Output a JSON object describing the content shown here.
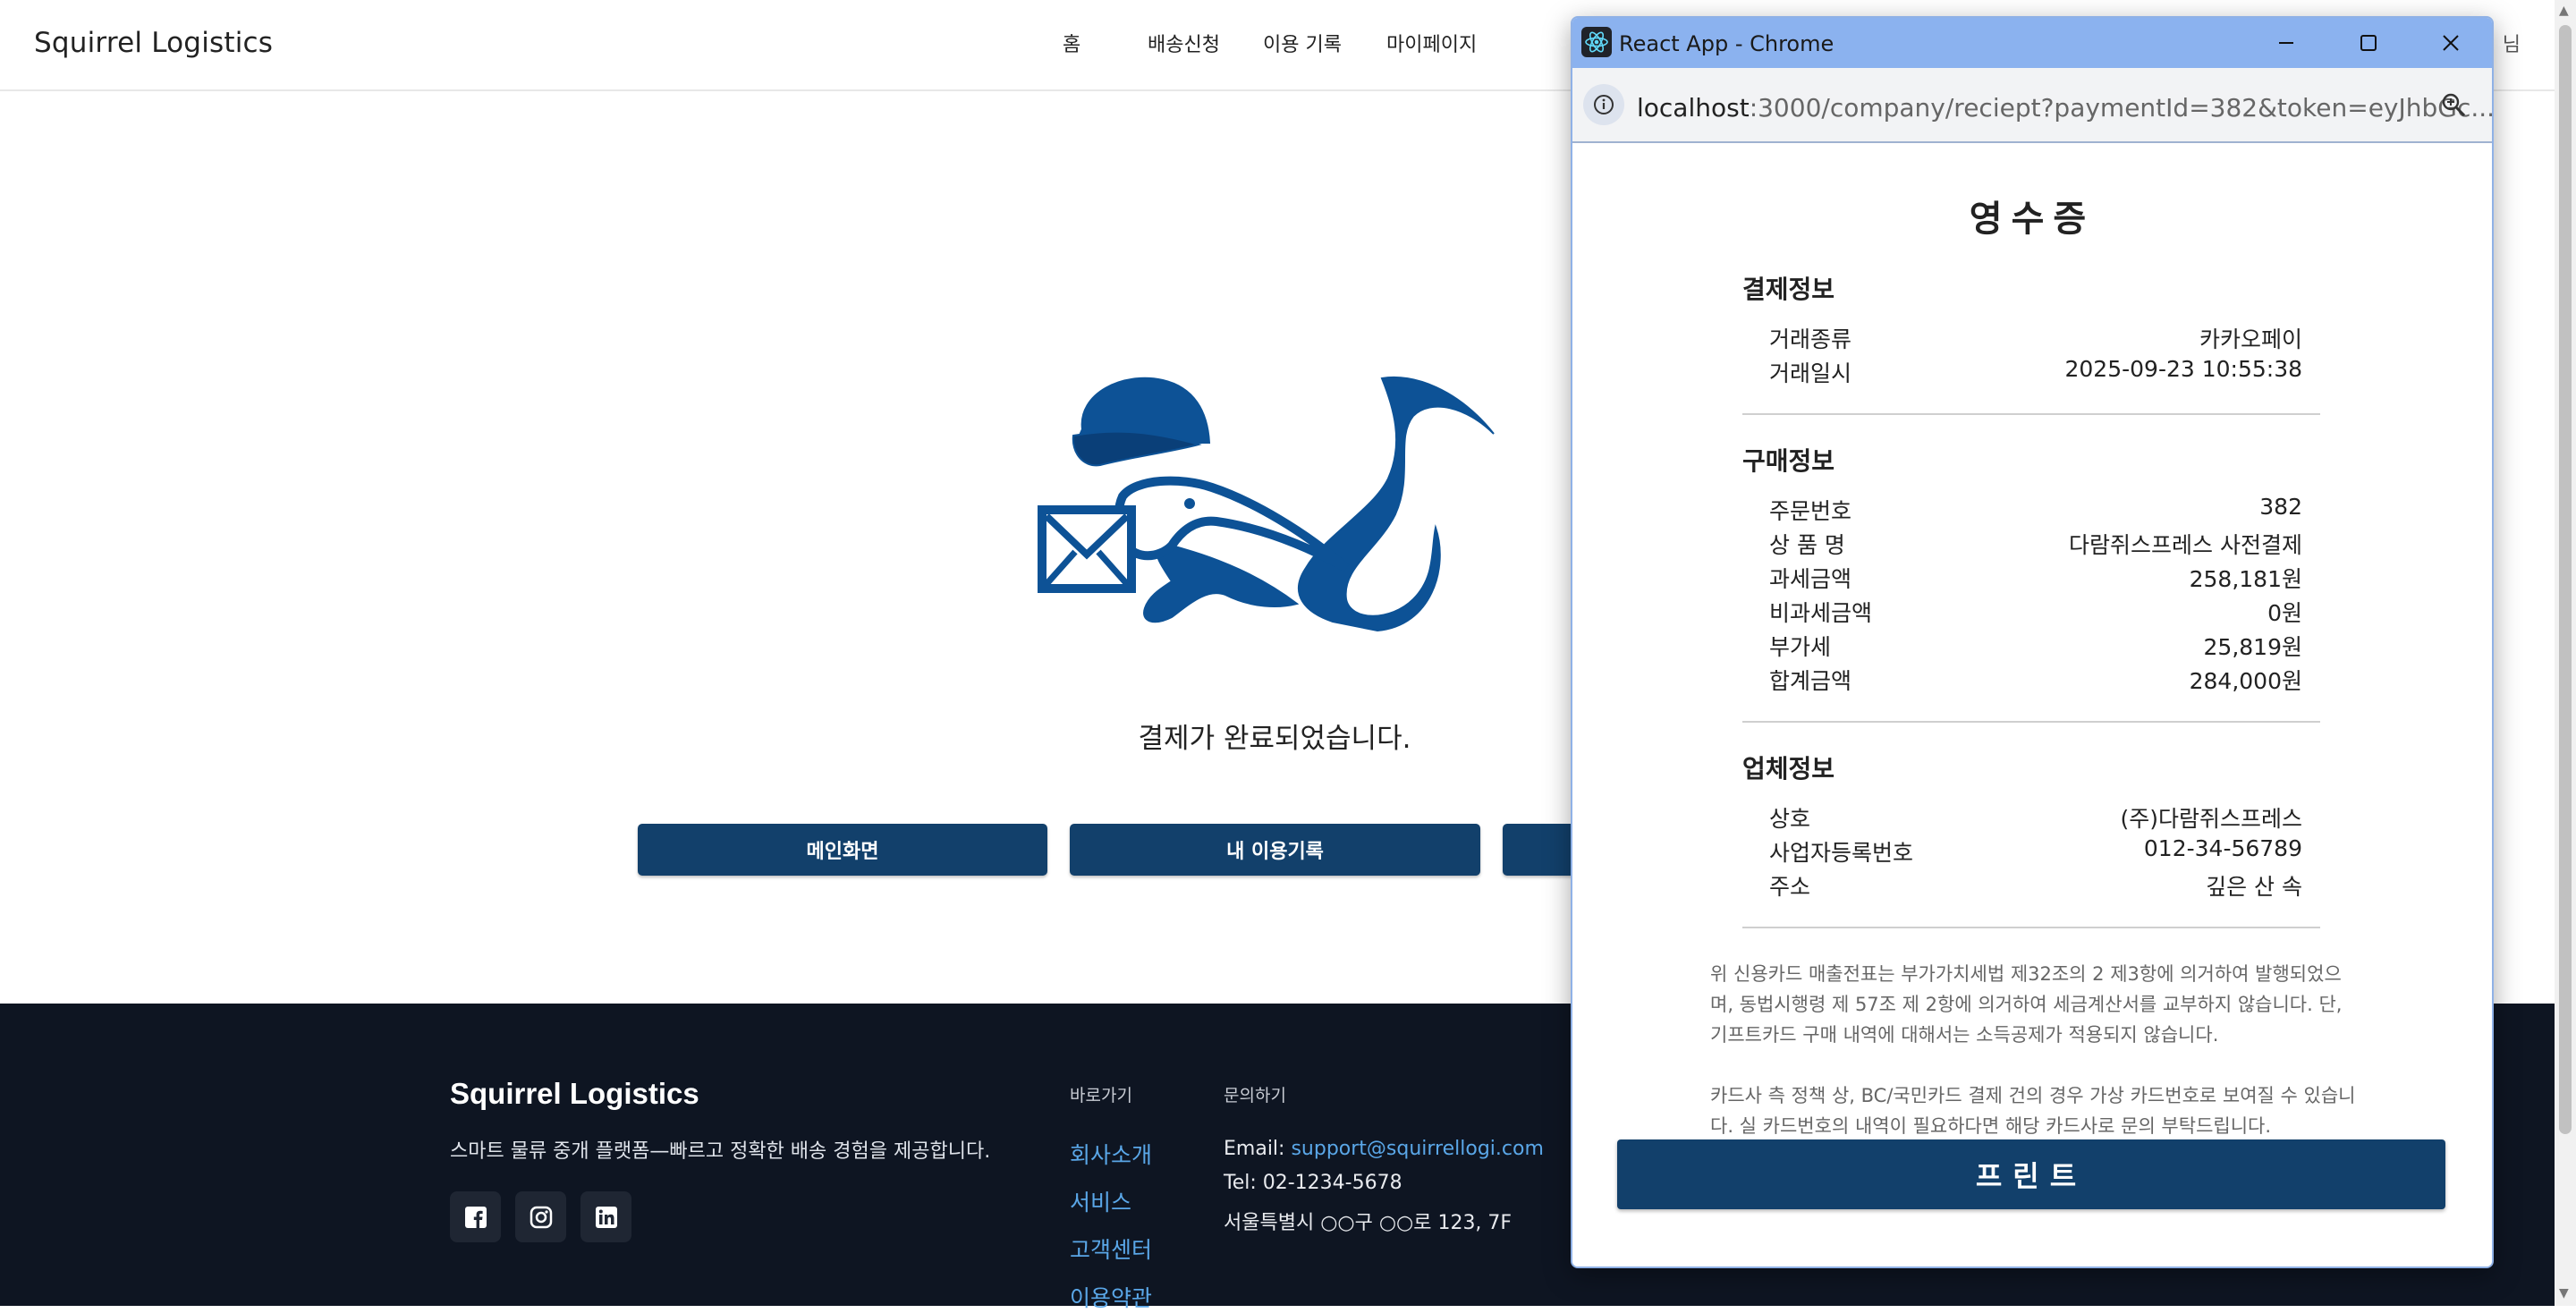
{
  "header": {
    "brand": "Squirrel Logistics",
    "nav": [
      "홈",
      "배송신청",
      "이용 기록",
      "마이페이지"
    ],
    "user_suffix": "님"
  },
  "main": {
    "message": "결제가 완료되었습니다.",
    "buttons": [
      "메인화면",
      "내 이용기록",
      ""
    ]
  },
  "footer": {
    "brand": "Squirrel Logistics",
    "description": "스마트 물류 중개 플랫폼—빠르고 정확한 배송 경험을 제공합니다.",
    "social": [
      "facebook-icon",
      "instagram-icon",
      "linkedin-icon"
    ],
    "quicklinks_title": "바로가기",
    "quicklinks": [
      "회사소개",
      "서비스",
      "고객센터",
      "이용약관"
    ],
    "contact_title": "문의하기",
    "email_label": "Email: ",
    "email": "support@squirrellogi.com",
    "tel": "Tel: 02-1234-5678",
    "address": "서울특별시 ○○구 ○○로 123, 7F"
  },
  "popup": {
    "title": "React App - Chrome",
    "url_host": "localhost",
    "url_rest": ":3000/company/reciept?paymentId=382&token=eyJhbGc...",
    "receipt": {
      "title": "영수증",
      "payment_section": "결제정보",
      "payment_rows": [
        {
          "k": "거래종류",
          "v": "카카오페이"
        },
        {
          "k": "거래일시",
          "v": "2025-09-23 10:55:38"
        }
      ],
      "purchase_section": "구매정보",
      "purchase_rows": [
        {
          "k": "주문번호",
          "v": "382"
        },
        {
          "k": "상 품 명",
          "v": "다람쥐스프레스 사전결제"
        },
        {
          "k": "과세금액",
          "v": "258,181원"
        },
        {
          "k": "비과세금액",
          "v": "0원"
        },
        {
          "k": "부가세",
          "v": "25,819원"
        },
        {
          "k": "합계금액",
          "v": "284,000원"
        }
      ],
      "company_section": "업체정보",
      "company_rows": [
        {
          "k": "상호",
          "v": "(주)다람쥐스프레스"
        },
        {
          "k": "사업자등록번호",
          "v": "012-34-56789"
        },
        {
          "k": "주소",
          "v": "깊은 산 속"
        }
      ],
      "notice1": "위 신용카드 매출전표는 부가가치세법 제32조의 2 제3항에 의거하여 발행되었으며, 동법시행령 제 57조 제 2항에 의거하여 세금계산서를 교부하지 않습니다. 단, 기프트카드 구매 내역에 대해서는 소득공제가 적용되지 않습니다.",
      "notice2": "카드사 측 정책 상, BC/국민카드 결제 건의 경우 가상 카드번호로 보여질 수 있습니다. 실 카드번호의 내역이 필요하다면 해당 카드사로 문의 부탁드립니다.",
      "print_label": "프린트"
    }
  },
  "colors": {
    "primary": "#12406b",
    "footer_bg": "#0e1522",
    "link": "#5aa7e8",
    "titlebar": "#8bb2ef",
    "logo_blue": "#0d5296"
  }
}
